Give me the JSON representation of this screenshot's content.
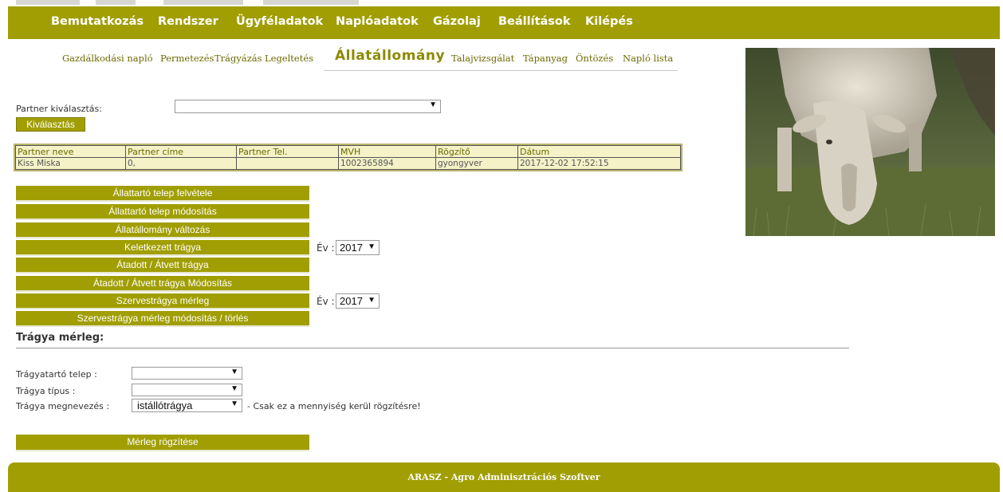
{
  "nav": {
    "items": [
      "Bemutatkozás",
      "Rendszer",
      "Ügyféladatok",
      "Naplóadatok",
      "Gázolaj",
      "Beállítások",
      "Kilépés"
    ]
  },
  "subnav": {
    "items": [
      "Gazdálkodási napló",
      "Permetezés",
      "Trágyázás",
      "Legeltetés",
      "Állatállomány",
      "Talajvizsgálat",
      "Tápanyag",
      "Öntözés",
      "Napló lista"
    ],
    "active": "Állatállomány"
  },
  "partner": {
    "label": "Partner kiválasztás:",
    "select_value": "",
    "button": "Kiválasztás"
  },
  "table": {
    "headers": [
      "Partner neve",
      "Partner címe",
      "Partner Tel.",
      "MVH",
      "Rögzítő",
      "Dátum"
    ],
    "rows": [
      [
        "Kiss Miska",
        "0,",
        "",
        "1002365894",
        "gyongyver",
        "2017-12-02 17:52:15"
      ]
    ]
  },
  "menu_buttons": [
    "Állattartó telep felvétele",
    "Állattartó telep módosítás",
    "Állatállomány változás",
    "Keletkezett trágya",
    "Átadott / Átvett trágya",
    "Átadott / Átvett trágya Módosítás",
    "Szervestrágya mérleg",
    "Szervestrágya mérleg módosítás / törlés"
  ],
  "year_selects": [
    {
      "label": "Év :",
      "value": "2017"
    },
    {
      "label": "Év :",
      "value": "2017"
    }
  ],
  "balance": {
    "title": "Trágya mérleg:",
    "fields": [
      {
        "label": "Trágyatartó telep :",
        "value": ""
      },
      {
        "label": "Trágya típus :",
        "value": ""
      },
      {
        "label": "Trágya megnevezés :",
        "value": "istállótrágya"
      }
    ],
    "note": "- Csak ez a mennyiség kerül rögzítésre!",
    "submit": "Mérleg rögzítése"
  },
  "footer": {
    "text": "ARASZ - Agro Adminisztrációs Szoftver"
  },
  "colors": {
    "brand": "#a19e03",
    "table_bg": "#f5f2c8"
  }
}
